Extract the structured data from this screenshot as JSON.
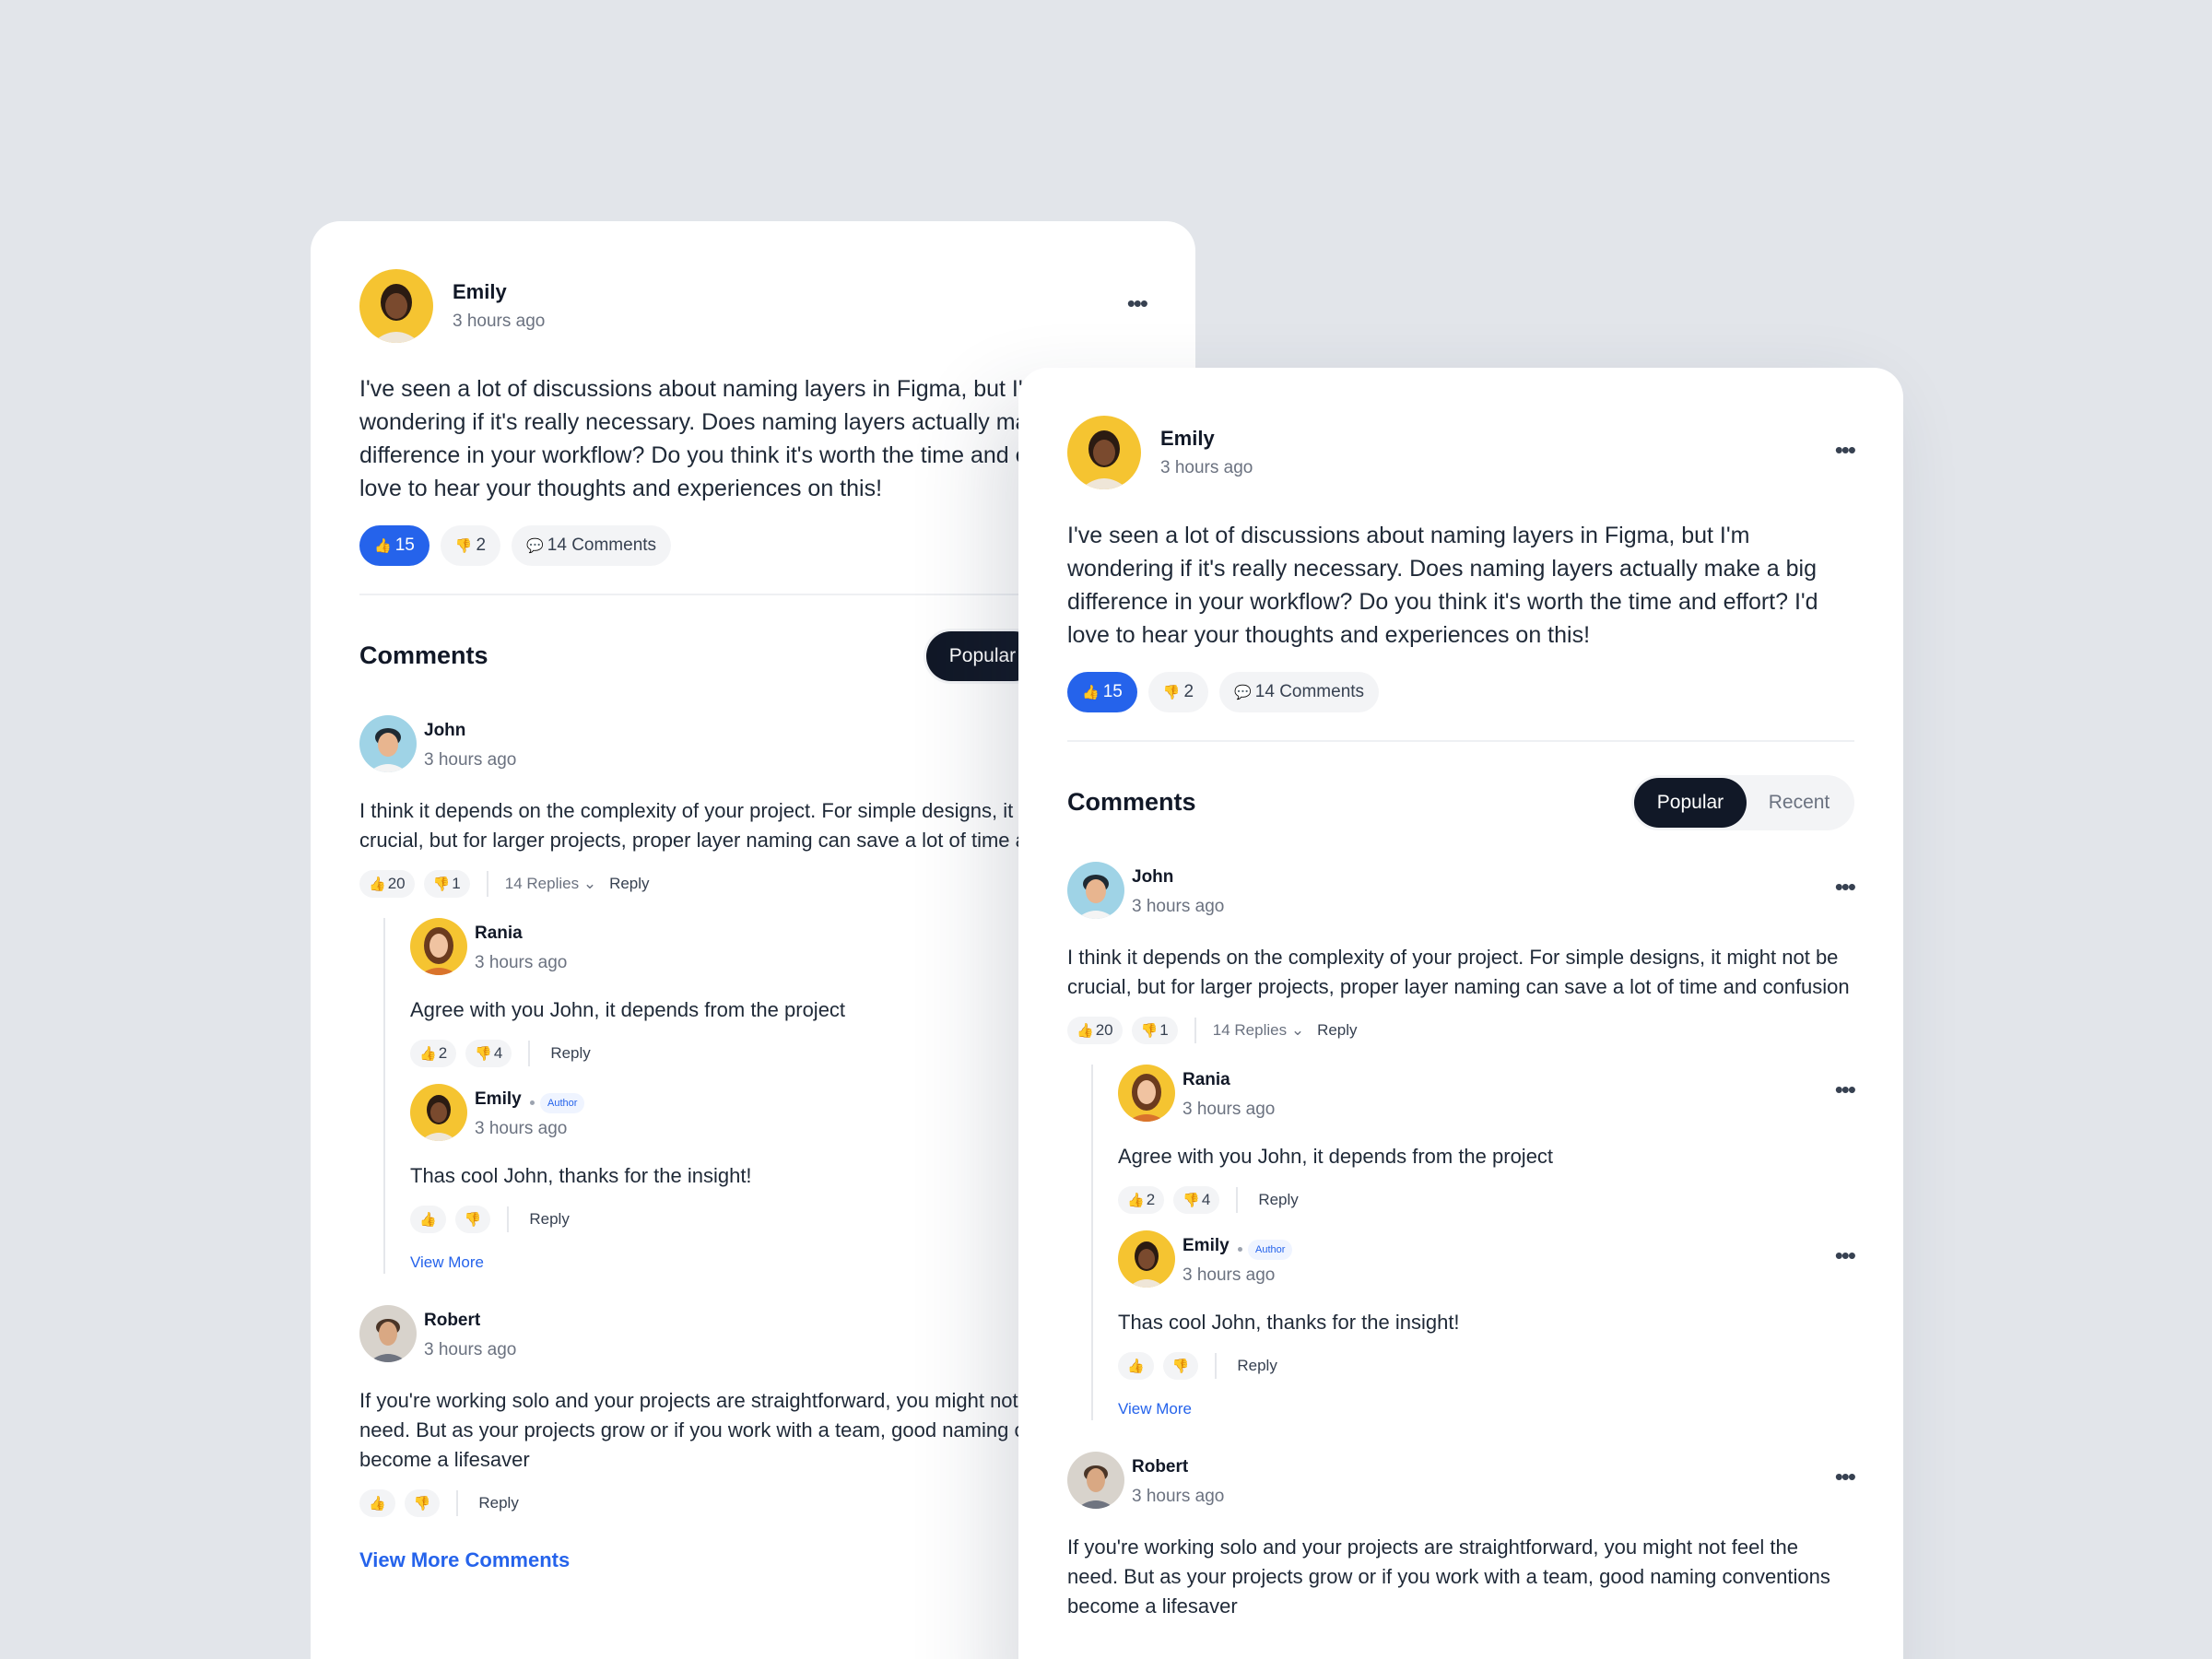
{
  "post": {
    "author": "Emily",
    "time": "3 hours ago",
    "body": "I've seen a lot of discussions about naming layers in Figma, but I'm wondering if it's really necessary. Does naming layers actually make a big difference in your workflow? Do you think it's worth the time and effort? I'd love to hear your thoughts and experiences on this!",
    "likes": "15",
    "dislikes": "2",
    "comments_label": "14 Comments"
  },
  "comments_section": {
    "title": "Comments",
    "tab_popular": "Popular",
    "tab_recent": "Recent",
    "view_more_comments": "View More Comments"
  },
  "comments": [
    {
      "author": "John",
      "time": "3 hours ago",
      "text": "I think it depends on the complexity of your project. For simple designs, it might not be crucial, but for larger projects, proper layer naming can save a lot of time and confusion",
      "likes": "20",
      "dislikes": "1",
      "replies_label": "14 Replies",
      "reply_label": "Reply"
    },
    {
      "author": "Robert",
      "time": "3 hours ago",
      "text": "If you're working solo and your projects are straightforward, you might not feel the need. But as your projects grow or if you work with a team, good naming conventions become a lifesaver",
      "reply_label": "Reply"
    }
  ],
  "replies": [
    {
      "author": "Rania",
      "time": "3 hours ago",
      "text": "Agree with you John, it depends from the project",
      "likes": "2",
      "dislikes": "4",
      "reply_label": "Reply"
    },
    {
      "author": "Emily",
      "badge": "Author",
      "time": "3 hours ago",
      "text": "Thas cool John, thanks for the insight!",
      "reply_label": "Reply"
    }
  ],
  "thread_view_more": "View More",
  "icons": {
    "like": "thumbs-up-icon",
    "dislike": "thumbs-down-icon",
    "comment": "speech-bubble-icon",
    "more": "more-dots-icon",
    "chevron": "chevron-down-icon"
  },
  "glyphs": {
    "like": "👍",
    "dislike": "👎",
    "comment": "💬",
    "more": "•••",
    "chevron": "⌄"
  },
  "colors": {
    "accent": "#2563eb",
    "dark": "#111827",
    "background": "#e2e5ea"
  }
}
